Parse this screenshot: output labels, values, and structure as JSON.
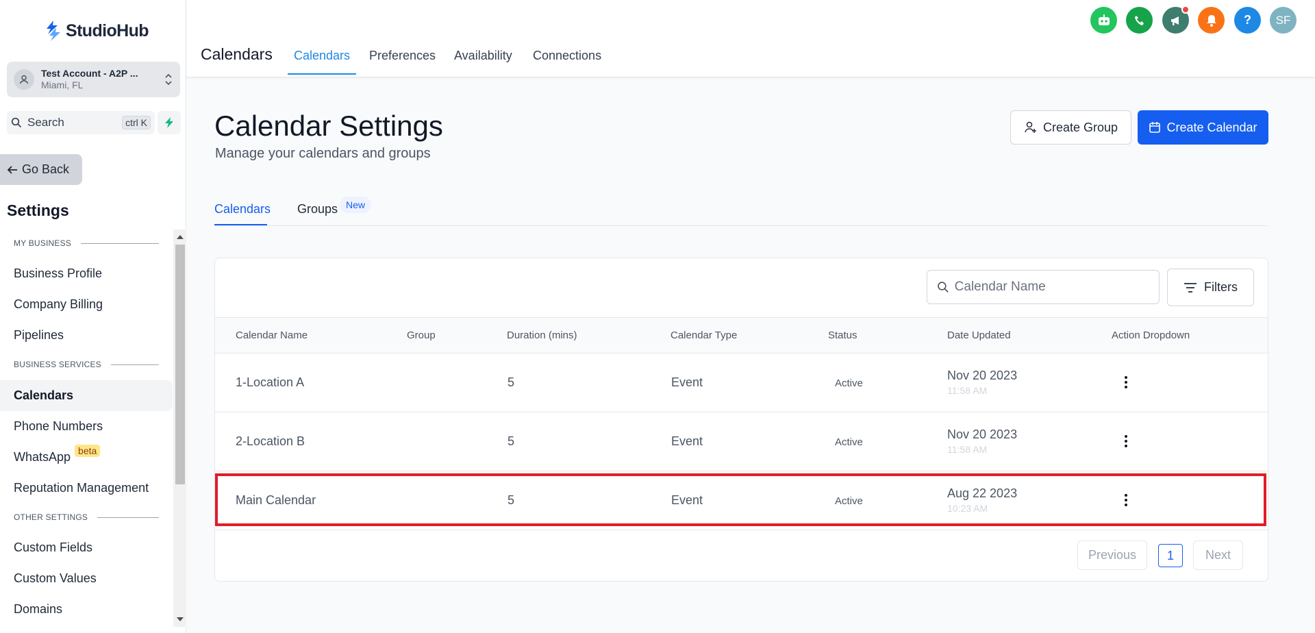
{
  "brand": {
    "name": "StudioHub",
    "color": "#155eef"
  },
  "account": {
    "name": "Test Account - A2P ...",
    "location": "Miami, FL"
  },
  "sidebar_search": {
    "label": "Search",
    "shortcut": "ctrl K"
  },
  "go_back": "Go Back",
  "settings_title": "Settings",
  "nav": {
    "my_business": "MY BUSINESS",
    "business_profile": "Business Profile",
    "company_billing": "Company Billing",
    "pipelines": "Pipelines",
    "business_services": "BUSINESS SERVICES",
    "calendars": "Calendars",
    "phone_numbers": "Phone Numbers",
    "whatsapp": "WhatsApp",
    "whatsapp_badge": "beta",
    "reputation": "Reputation Management",
    "other_settings": "OTHER SETTINGS",
    "custom_fields": "Custom Fields",
    "custom_values": "Custom Values",
    "domains": "Domains"
  },
  "header": {
    "title": "Calendars",
    "tabs": [
      "Calendars",
      "Preferences",
      "Availability",
      "Connections"
    ],
    "active_tab": "Calendars",
    "avatar_initials": "SF",
    "help_glyph": "?",
    "icons": [
      "robot-icon",
      "phone-icon",
      "megaphone-icon",
      "bell-icon",
      "help-icon",
      "avatar"
    ]
  },
  "page": {
    "title": "Calendar Settings",
    "subtitle": "Manage your calendars and groups",
    "create_group": "Create Group",
    "create_calendar": "Create Calendar"
  },
  "content_tabs": {
    "calendars": "Calendars",
    "groups": "Groups",
    "groups_badge": "New"
  },
  "table": {
    "search_placeholder": "Calendar Name",
    "filters_label": "Filters",
    "columns": [
      "Calendar Name",
      "Group",
      "Duration (mins)",
      "Calendar Type",
      "Status",
      "Date Updated",
      "Action Dropdown"
    ],
    "rows": [
      {
        "name": "1-Location A",
        "group": "",
        "duration": "5",
        "type": "Event",
        "status": "Active",
        "date": "Nov 20 2023",
        "time": "11:58 AM"
      },
      {
        "name": "2-Location B",
        "group": "",
        "duration": "5",
        "type": "Event",
        "status": "Active",
        "date": "Nov 20 2023",
        "time": "11:58 AM"
      },
      {
        "name": "Main Calendar",
        "group": "",
        "duration": "5",
        "type": "Event",
        "status": "Active",
        "date": "Aug 22 2023",
        "time": "10:23 AM"
      }
    ],
    "highlighted_row": "Main Calendar"
  },
  "pagination": {
    "previous": "Previous",
    "page": "1",
    "next": "Next"
  }
}
